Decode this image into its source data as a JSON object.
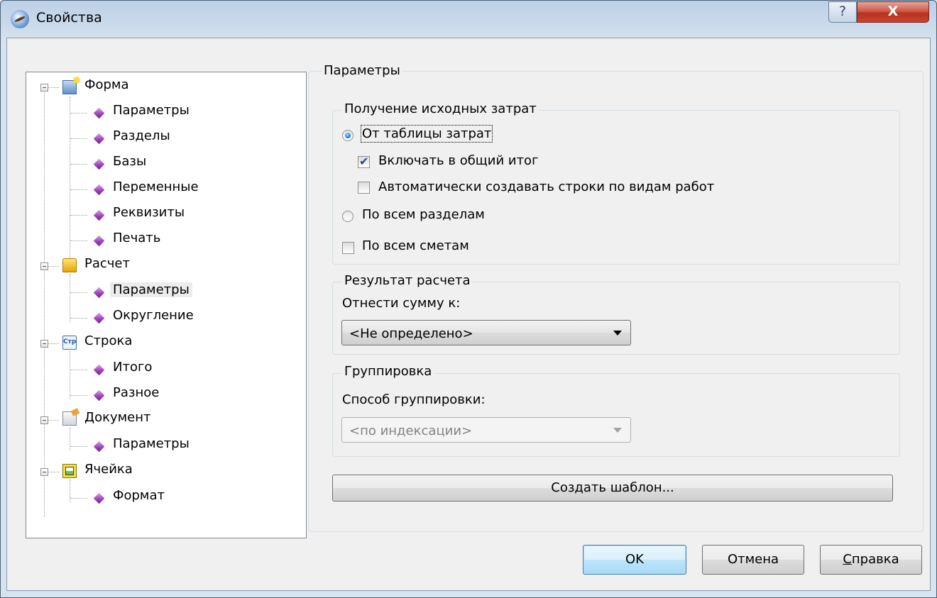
{
  "window": {
    "title": "Свойства",
    "help_glyph": "?",
    "close_glyph": "X"
  },
  "tree": {
    "categories": [
      {
        "label": "Форма",
        "icon": "form-icon",
        "children": [
          "Параметры",
          "Разделы",
          "Базы",
          "Переменные",
          "Реквизиты",
          "Печать"
        ]
      },
      {
        "label": "Расчет",
        "icon": "coins-icon",
        "children": [
          "Параметры",
          "Округление"
        ]
      },
      {
        "label": "Строка",
        "icon": "row-icon",
        "icon_text": "Стр",
        "children": [
          "Итого",
          "Разное"
        ]
      },
      {
        "label": "Документ",
        "icon": "document-icon",
        "children": [
          "Параметры"
        ]
      },
      {
        "label": "Ячейка",
        "icon": "cell-icon",
        "children": [
          "Формат"
        ]
      }
    ],
    "selected": "Расчет / Параметры"
  },
  "params": {
    "title": "Параметры",
    "source": {
      "title": "Получение исходных затрат",
      "from_table_label": "От таблицы затрат",
      "from_table_checked": true,
      "include_total_label": "Включать в общий итог",
      "include_total_checked": true,
      "auto_rows_label": "Автоматически создавать строки по видам работ",
      "auto_rows_checked": false,
      "all_sections_label": "По всем разделам",
      "all_sections_checked": false,
      "all_estimates_label": "По всем сметам",
      "all_estimates_checked": false
    },
    "result": {
      "title": "Результат расчета",
      "assign_label": "Отнести сумму к:",
      "assign_value": "<Не определено>"
    },
    "grouping": {
      "title": "Группировка",
      "method_label": "Способ группировки:",
      "method_value": "<по индексации>",
      "method_disabled": true
    },
    "create_template_label": "Создать шаблон..."
  },
  "buttons": {
    "ok": "OK",
    "cancel": "Отмена",
    "help_underlined": "С",
    "help_rest": "правка"
  },
  "colors": {
    "close_button": "#c8432f",
    "tree_leaf_icon": "#9b3fb8",
    "radio_checked": "#0d6fd1",
    "check_mark": "#23468a"
  }
}
